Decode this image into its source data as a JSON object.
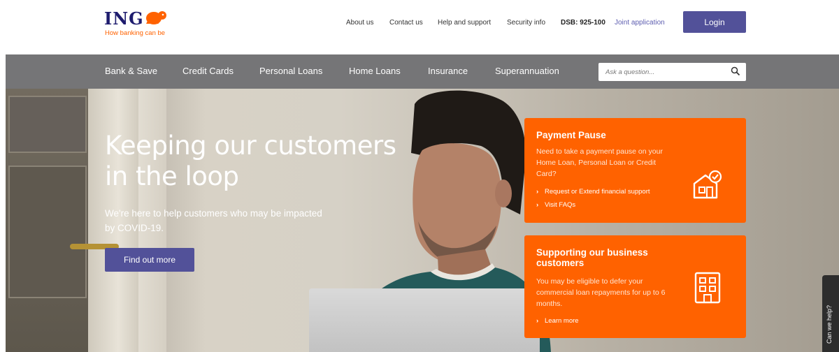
{
  "brand": {
    "name": "ING",
    "tagline": "How banking can be",
    "colors": {
      "orange": "#ff6200",
      "navy": "#1e1c6e",
      "button": "#525199",
      "nav_bg": "#757577"
    }
  },
  "header": {
    "links": [
      "About us",
      "Contact us",
      "Help and support",
      "Security info"
    ],
    "phone": "DSB: 925-100",
    "joint_application": "Joint application",
    "login_label": "Login"
  },
  "nav": {
    "items": [
      "Bank & Save",
      "Credit Cards",
      "Personal Loans",
      "Home Loans",
      "Insurance",
      "Superannuation"
    ],
    "search_placeholder": "Ask a question..."
  },
  "hero": {
    "headline": "Keeping our customers in the loop",
    "subtext": "We're here to help customers who may be impacted by COVID-19.",
    "cta_label": "Find out more"
  },
  "cards": [
    {
      "title": "Payment Pause",
      "body": "Need to take a payment pause on your Home Loan, Personal Loan or Credit Card?",
      "links": [
        "Request or Extend financial support",
        "Visit FAQs"
      ],
      "icon": "home-check-icon"
    },
    {
      "title": "Supporting our business customers",
      "body": "You may be eligible to defer your commercial loan repayments for up to 6 months.",
      "links": [
        "Learn more"
      ],
      "icon": "building-icon"
    }
  ],
  "help_tab": {
    "label": "Can we help?"
  }
}
